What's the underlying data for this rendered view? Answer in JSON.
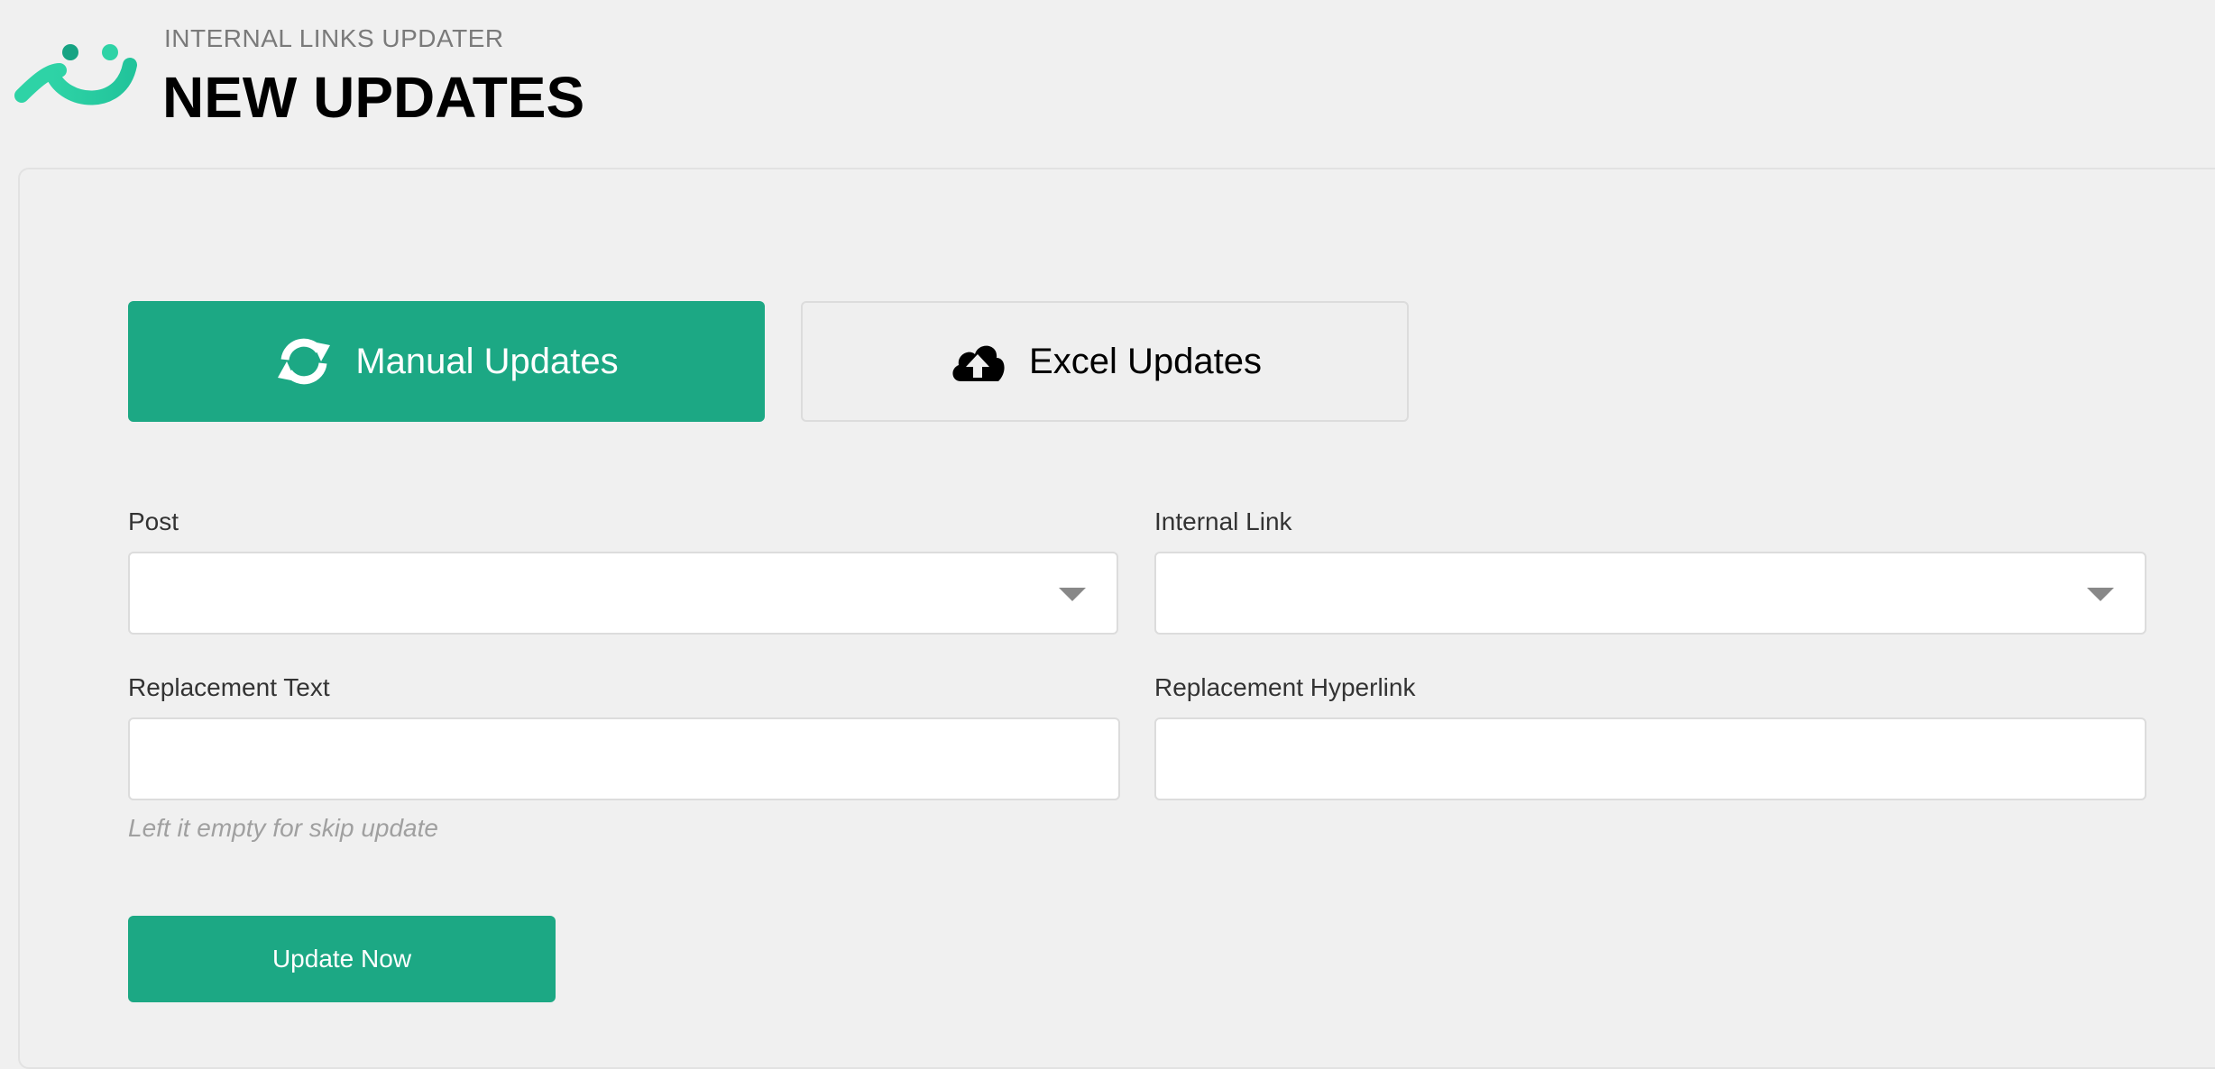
{
  "header": {
    "subtitle": "INTERNAL LINKS UPDATER",
    "title": "NEW UPDATES",
    "logo_icon": "smile-logo-icon"
  },
  "tabs": [
    {
      "label": "Manual Updates",
      "icon": "sync-icon",
      "active": true
    },
    {
      "label": "Excel Updates",
      "icon": "cloud-upload-icon",
      "active": false
    }
  ],
  "form": {
    "post": {
      "label": "Post",
      "value": ""
    },
    "internal_link": {
      "label": "Internal Link",
      "value": ""
    },
    "replacement_text": {
      "label": "Replacement Text",
      "value": "",
      "hint": "Left it empty for skip update"
    },
    "replacement_hyperlink": {
      "label": "Replacement Hyperlink",
      "value": ""
    },
    "submit_label": "Update Now"
  },
  "colors": {
    "accent": "#1ca884",
    "background": "#f0f0f0",
    "logo_light": "#2ed3a6",
    "logo_dark": "#16a383"
  }
}
